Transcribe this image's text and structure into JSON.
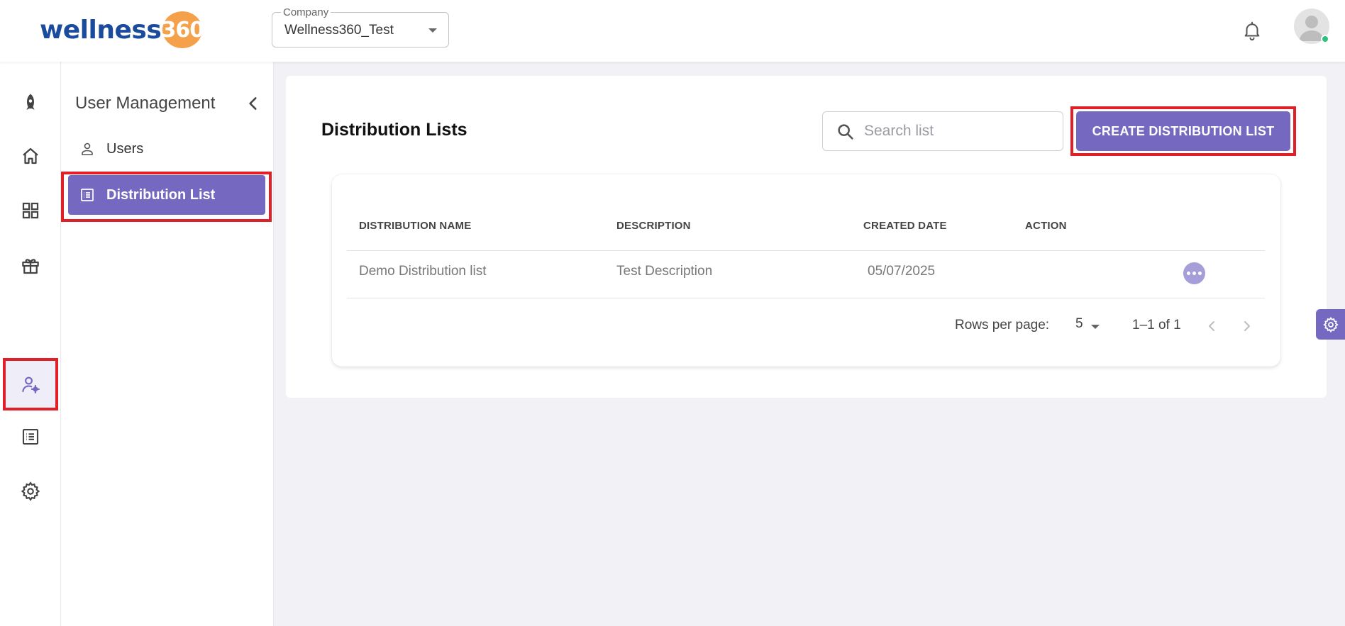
{
  "brand": {
    "word": "wellness",
    "number": "360"
  },
  "company": {
    "label": "Company",
    "value": "Wellness360_Test"
  },
  "icons": {
    "notifications": "bell-icon",
    "rail": [
      "rocket-icon",
      "home-icon",
      "grid-icon",
      "gift-icon",
      "user-settings-icon",
      "list-icon",
      "gear-icon"
    ]
  },
  "sidebar": {
    "title": "User Management",
    "items": [
      {
        "label": "Users",
        "icon": "user-icon",
        "active": false
      },
      {
        "label": "Distribution List",
        "icon": "list-icon",
        "active": true
      }
    ]
  },
  "main": {
    "title": "Distribution Lists",
    "search_placeholder": "Search list",
    "create_label": "CREATE DISTRIBUTION LIST"
  },
  "table": {
    "columns": [
      "DISTRIBUTION NAME",
      "DESCRIPTION",
      "CREATED DATE",
      "ACTION"
    ],
    "rows": [
      {
        "name": "Demo Distribution list",
        "description": "Test Description",
        "created": "05/07/2025"
      }
    ]
  },
  "pagination": {
    "rows_label": "Rows per page:",
    "rows_value": "5",
    "range": "1–1 of 1"
  },
  "colors": {
    "accent": "#7468c0",
    "highlight": "#e01f26",
    "brand_blue": "#1a4b9c",
    "brand_orange": "#f5a04a",
    "online": "#2ec27e"
  }
}
